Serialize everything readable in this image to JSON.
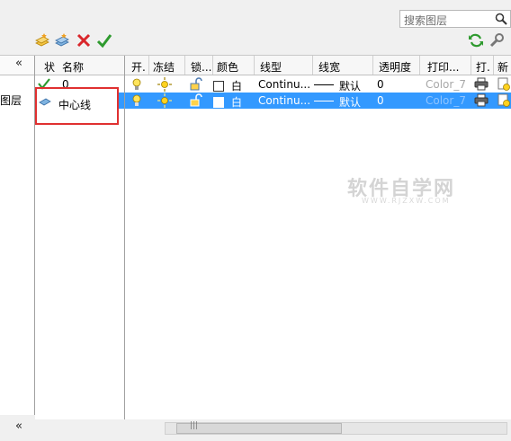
{
  "search": {
    "placeholder": "搜索图层"
  },
  "left_panel": {
    "collapse": "«",
    "item": "图层"
  },
  "name_columns": {
    "status": "状",
    "name": "名称"
  },
  "grid_columns": [
    "开.",
    "冻结",
    "锁...",
    "颜色",
    "线型",
    "线宽",
    "透明度",
    "打印...",
    "打.",
    "新"
  ],
  "layers": [
    {
      "name": "0",
      "color": "白",
      "linetype": "Continu...",
      "lineweight": "默认",
      "transparency": "0",
      "plot_style": "Color_7",
      "selected": false
    },
    {
      "name": "中心线",
      "color": "白",
      "linetype": "Continu...",
      "lineweight": "默认",
      "transparency": "0",
      "plot_style": "Color_7",
      "selected": true
    }
  ],
  "scroll_grip": "|||",
  "watermark": {
    "main": "软件自学网",
    "sub": "WWW.RJZXW.COM"
  },
  "colors": {
    "selection": "#3399ff",
    "highlight_box": "#e03030"
  }
}
